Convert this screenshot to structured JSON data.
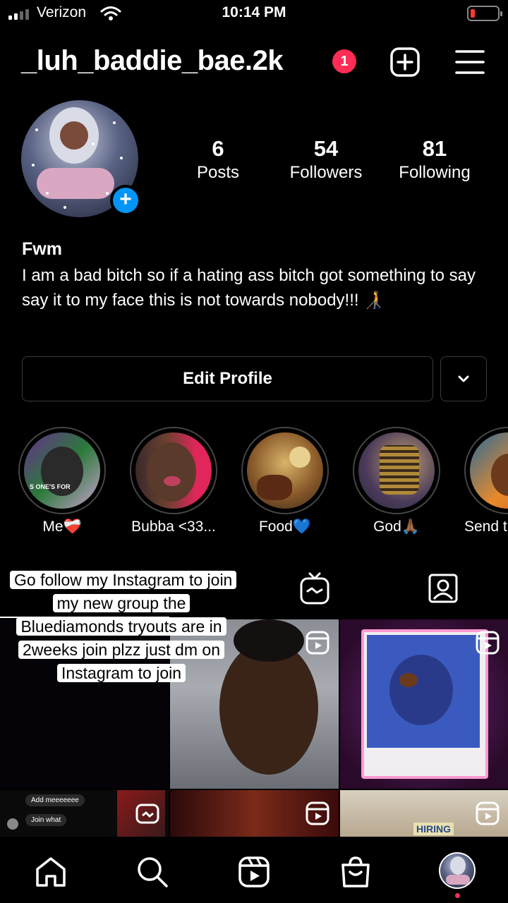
{
  "status_bar": {
    "carrier": "Verizon",
    "time": "10:14 PM",
    "signal_bars": 2,
    "battery_level": 0.1,
    "battery_color": "#ff3b30"
  },
  "header": {
    "username": "_luh_baddie_bae.2k",
    "notification_count": "1",
    "badge_color": "#ff2d55",
    "new_post_icon": "plus-square-icon",
    "menu_icon": "hamburger-menu-icon"
  },
  "profile": {
    "add_story_icon": "plus-icon",
    "accent_color": "#0095f6",
    "stats": [
      {
        "value": "6",
        "label": "Posts"
      },
      {
        "value": "54",
        "label": "Followers"
      },
      {
        "value": "81",
        "label": "Following"
      }
    ],
    "bio_name": "Fwm",
    "bio_text": "I am a bad bitch so if a hating ass bitch got something to say say it to my face this is not towards nobody!!! 🧑‍🦯",
    "edit_profile_label": "Edit Profile",
    "dropdown_icon": "chevron-down-icon"
  },
  "highlights": [
    {
      "label": "Me❤️‍🩹"
    },
    {
      "label": "Bubba <33..."
    },
    {
      "label": "Food💙"
    },
    {
      "label": "God🙏🏾"
    },
    {
      "label": "Send th"
    }
  ],
  "highlight_thumbnail_text": "S ONE'S FOR",
  "tabs": [
    {
      "name": "grid-tab",
      "icon": "grid-icon"
    },
    {
      "name": "igtv-tab",
      "icon": "igtv-icon"
    },
    {
      "name": "tagged-tab",
      "icon": "tagged-person-icon"
    }
  ],
  "overlay_caption": "Go follow my Instagram to join my new group the Bluediamonds tryouts are in 2weeks join plzz just dm on Instagram to join",
  "grid": {
    "chat_bubbles": [
      "Add meeeeeee",
      "Join what"
    ],
    "sign_text": "HIRING"
  },
  "bottom_nav": [
    {
      "name": "home",
      "icon": "home-icon"
    },
    {
      "name": "search",
      "icon": "search-icon"
    },
    {
      "name": "reels",
      "icon": "reels-icon"
    },
    {
      "name": "shop",
      "icon": "shopping-bag-icon"
    },
    {
      "name": "profile",
      "icon": "profile-avatar-icon"
    }
  ]
}
